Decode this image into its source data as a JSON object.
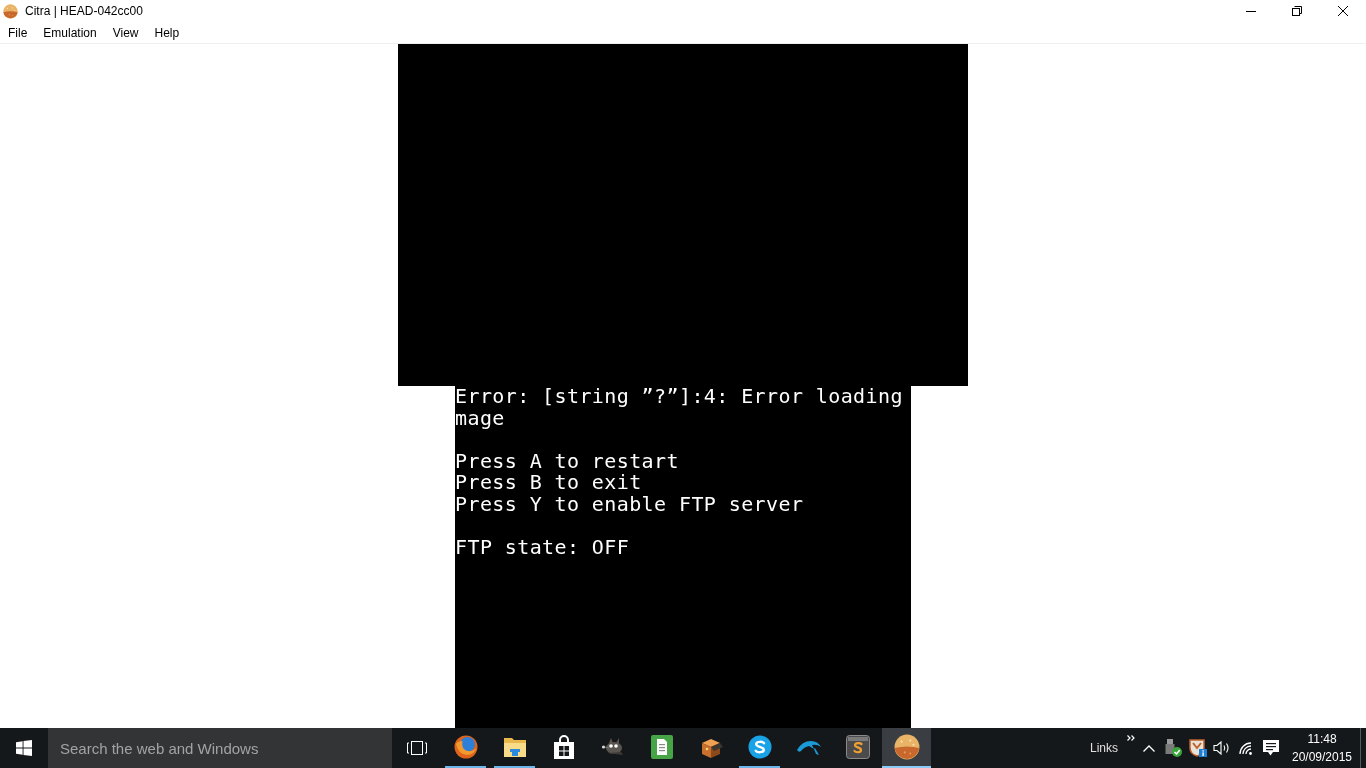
{
  "window": {
    "title": "Citra | HEAD-042cc00"
  },
  "menu_bar": {
    "items": [
      "File",
      "Emulation",
      "View",
      "Help"
    ]
  },
  "emulator": {
    "bottom_screen": {
      "blocks": [
        [
          "Error: [string ”?”]:4: Error loading",
          "mage"
        ],
        [
          "Press A to restart",
          "Press B to exit",
          "Press Y to enable FTP server"
        ],
        [
          "FTP state: OFF"
        ]
      ]
    }
  },
  "taskbar": {
    "search": {
      "placeholder": "Search the web and Windows"
    },
    "apps": [
      {
        "running": true,
        "selected": false
      },
      {
        "running": true,
        "selected": false
      },
      {
        "running": false,
        "selected": false
      },
      {
        "running": false,
        "selected": false
      },
      {
        "running": false,
        "selected": false
      },
      {
        "running": false,
        "selected": false
      },
      {
        "running": true,
        "selected": false
      },
      {
        "running": false,
        "selected": false
      },
      {
        "running": false,
        "selected": false
      },
      {
        "running": true,
        "selected": true
      }
    ],
    "tray": {
      "toolbar_label": "Links",
      "time": "11:48",
      "date": "20/09/2015"
    }
  }
}
